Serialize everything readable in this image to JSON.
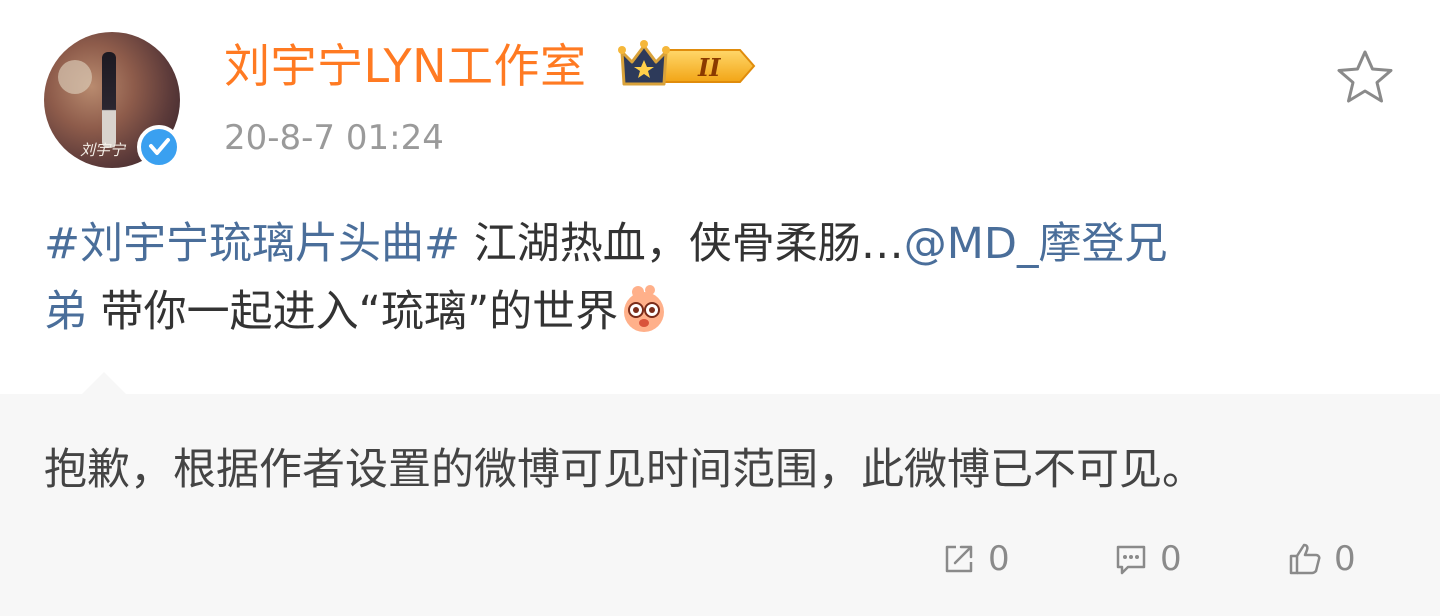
{
  "header": {
    "user_name": "刘宇宁LYN工作室",
    "timestamp": "20-8-7 01:24",
    "avatar_signature": "刘宇宁",
    "crown_level": "II",
    "icons": {
      "verified": "verified-check-icon",
      "crown": "crown-level-icon",
      "favorite": "star-outline-icon"
    }
  },
  "post": {
    "line1": {
      "hashtag": "#刘宇宁琉璃片头曲#",
      "text": " 江湖热血，侠骨柔肠…",
      "mention_part1": "@MD_摩登兄"
    },
    "line2": {
      "mention_part2": "弟",
      "text": " 带你一起进入“琉璃”的世界",
      "emoji": "emoji-face-icon"
    }
  },
  "retweet": {
    "notice": "抱歉，根据作者设置的微博可见时间范围，此微博已不可见。"
  },
  "actions": {
    "share_count": "0",
    "comment_count": "0",
    "like_count": "0",
    "icons": {
      "share": "share-icon",
      "comment": "comment-icon",
      "like": "thumbs-up-icon"
    }
  },
  "colors": {
    "user_name": "#ff7a22",
    "link": "#4a6e9a",
    "timestamp": "#9a9a9a",
    "retweet_bg": "#f7f7f7",
    "verified": "#3aa0f0"
  }
}
